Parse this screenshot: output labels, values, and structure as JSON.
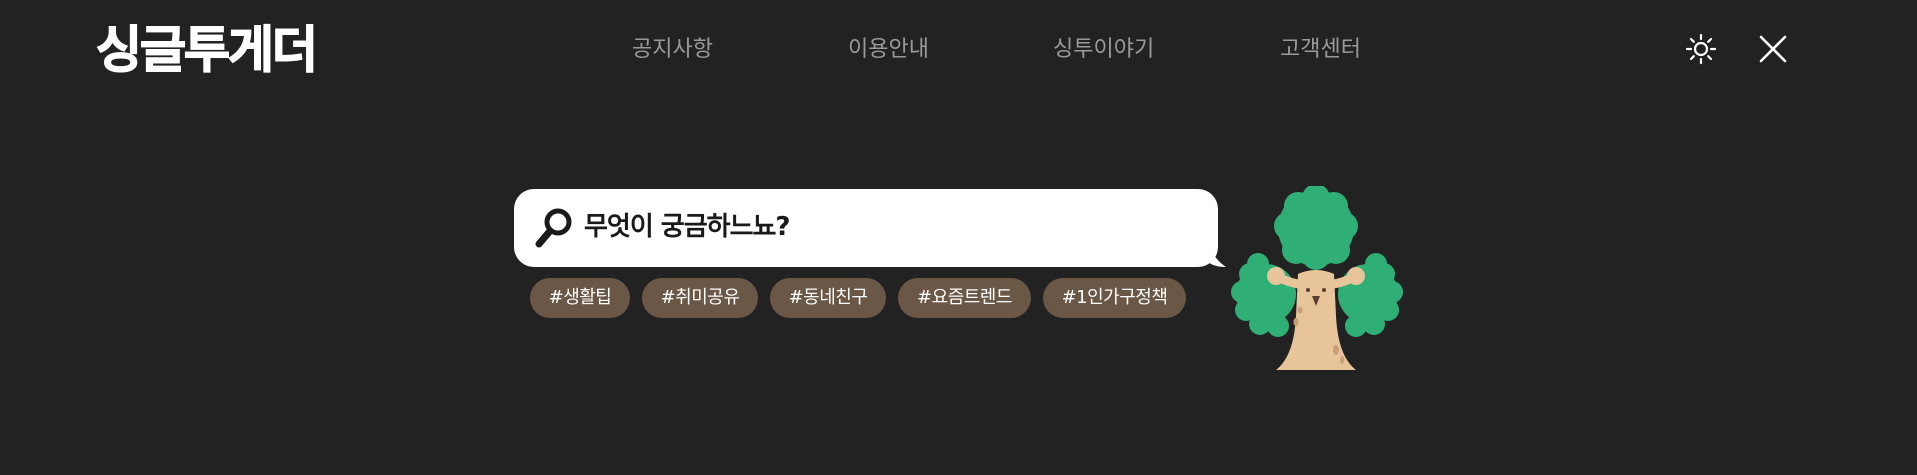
{
  "header": {
    "logo": "싱글투게더",
    "nav": [
      "공지사항",
      "이용안내",
      "싱투이야기",
      "고객센터"
    ],
    "theme_icon": "sun-icon",
    "close_icon": "close-icon"
  },
  "search": {
    "placeholder": "무엇이 궁금하느뇨?",
    "icon": "magnifier-icon"
  },
  "tags": [
    "#생활팁",
    "#취미공유",
    "#동네친구",
    "#요즘트렌드",
    "#1인가구정책"
  ],
  "mascot": "tree-mascot",
  "colors": {
    "background": "#222222",
    "nav_text": "#9a9a9a",
    "tag_bg": "#6a5746",
    "tree_green": "#2fae76",
    "trunk": "#e8c49a"
  }
}
